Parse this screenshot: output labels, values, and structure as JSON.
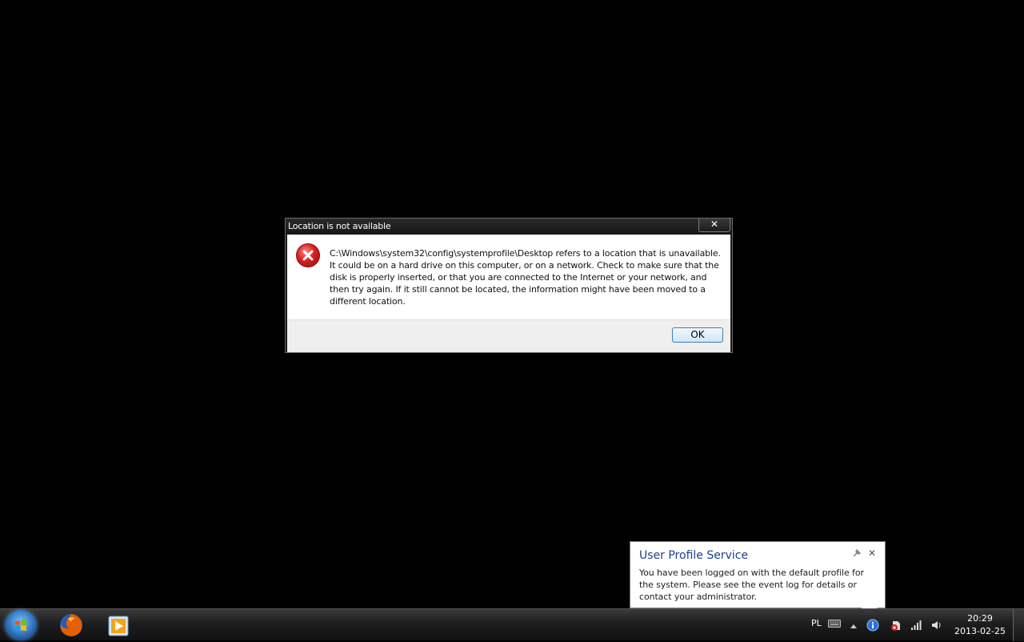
{
  "dialog": {
    "title": "Location is not available",
    "close_glyph": "✕",
    "icon": "error-icon",
    "message": "C:\\Windows\\system32\\config\\systemprofile\\Desktop refers to a location that is unavailable. It could be on a hard drive on this computer, or on a network. Check to make sure that the disk is properly inserted, or that you are connected to the Internet or your network, and then try again. If it still cannot be located, the information might have been moved to a different location.",
    "ok_label": "OK"
  },
  "balloon": {
    "title": "User Profile Service",
    "text": "You have been logged on with the default profile for the system. Please see the event log for details or contact your administrator.",
    "settings_glyph": "🔧",
    "close_glyph": "✕"
  },
  "taskbar": {
    "pinned": [
      "firefox-icon",
      "media-player-icon"
    ],
    "tray": {
      "language": "PL",
      "time": "20:29",
      "date": "2013-02-25"
    }
  },
  "colors": {
    "desktop": "#000000",
    "balloon_title": "#1b3f91",
    "ok_border": "#3c7fb1"
  }
}
